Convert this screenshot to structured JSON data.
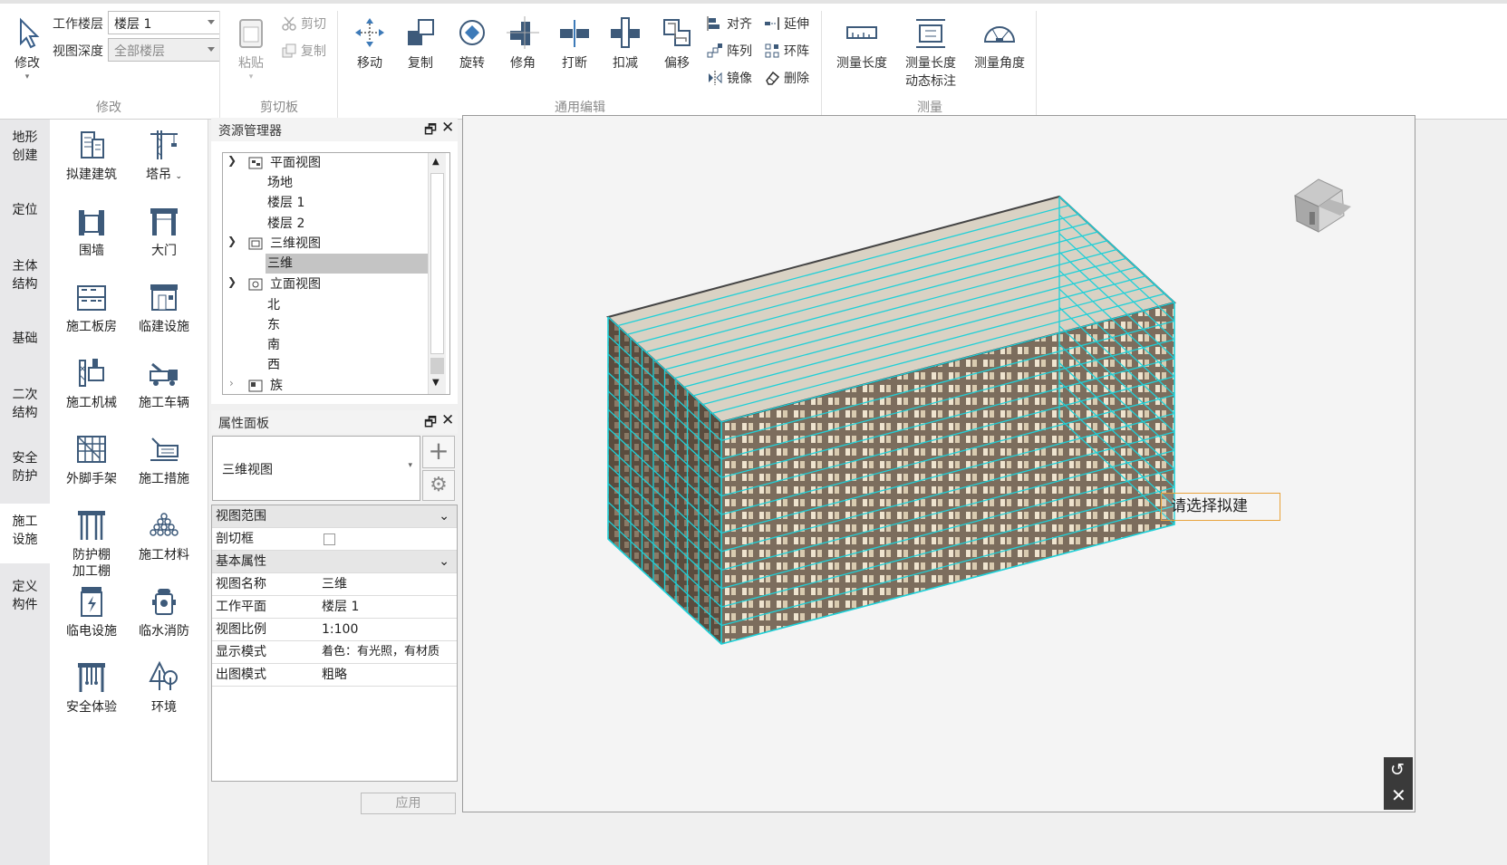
{
  "ribbon": {
    "modify": {
      "work_floor_label": "工作楼层",
      "work_floor_value": "楼层 1",
      "view_depth_label": "视图深度",
      "view_depth_value": "全部楼层",
      "modify_btn": "修改",
      "group": "修改"
    },
    "clipboard": {
      "paste": "粘贴",
      "cut": "剪切",
      "copy": "复制",
      "group": "剪切板"
    },
    "edit": {
      "move": "移动",
      "duplicate": "复制",
      "rotate": "旋转",
      "trim": "修角",
      "break": "打断",
      "deduct": "扣减",
      "offset": "偏移",
      "align": "对齐",
      "array": "阵列",
      "mirror": "镜像",
      "extend": "延伸",
      "ring_array": "环阵",
      "delete": "删除",
      "group": "通用编辑"
    },
    "measure": {
      "length": "测量长度",
      "dynamic_l1": "测量长度",
      "dynamic_l2": "动态标注",
      "angle": "测量角度",
      "group": "测量"
    }
  },
  "categories": [
    "地形\n创建",
    "定位",
    "主体\n结构",
    "基础",
    "二次\n结构",
    "安全\n防护",
    "施工\n设施",
    "定义\n构件"
  ],
  "palette": [
    [
      "拟建建筑",
      "塔吊"
    ],
    [
      "围墙",
      "大门"
    ],
    [
      "施工板房",
      "临建设施"
    ],
    [
      "施工机械",
      "施工车辆"
    ],
    [
      "外脚手架",
      "施工措施"
    ],
    [
      "防护棚\n加工棚",
      "施工材料"
    ],
    [
      "临电设施",
      "临水消防"
    ],
    [
      "安全体验",
      "环境"
    ]
  ],
  "resource_manager": {
    "title": "资源管理器",
    "nodes": [
      {
        "label": "平面视图",
        "level": 0
      },
      {
        "label": "场地",
        "level": 1
      },
      {
        "label": "楼层 1",
        "level": 1
      },
      {
        "label": "楼层 2",
        "level": 1
      },
      {
        "label": "三维视图",
        "level": 0
      },
      {
        "label": "三维",
        "level": 1
      },
      {
        "label": "立面视图",
        "level": 0
      },
      {
        "label": "北",
        "level": 1
      },
      {
        "label": "东",
        "level": 1
      },
      {
        "label": "南",
        "level": 1
      },
      {
        "label": "西",
        "level": 1
      },
      {
        "label": "族",
        "level": 0
      }
    ]
  },
  "properties": {
    "title": "属性面板",
    "type_value": "三维视图",
    "section_view_range": "视图范围",
    "section_box_label": "剖切框",
    "section_basic": "基本属性",
    "rows": [
      {
        "k": "视图名称",
        "v": "三维"
      },
      {
        "k": "工作平面",
        "v": "楼层 1"
      },
      {
        "k": "视图比例",
        "v": "1:100"
      },
      {
        "k": "显示模式",
        "v": "着色：有光照，有材质"
      },
      {
        "k": "出图模式",
        "v": "粗略"
      }
    ],
    "apply": "应用"
  },
  "viewport": {
    "tooltip": "请选择拟建"
  },
  "colors": {
    "edge": "#1fd0d8",
    "roof": "#d8d0c2",
    "facade": "#7a6a58"
  }
}
